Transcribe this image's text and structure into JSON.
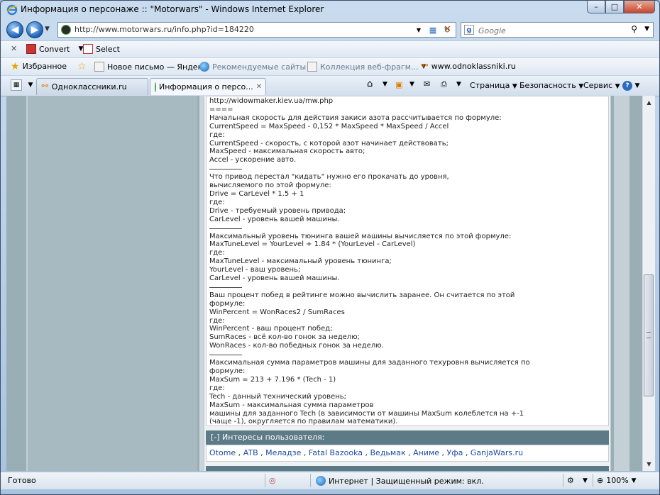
{
  "window": {
    "title": "Информация о персонаже :: \"Motorwars\" - Windows Internet Explorer",
    "minimize": "–",
    "maximize": "□",
    "close": "✕"
  },
  "nav": {
    "back": "◀",
    "forward": "▶",
    "url": "http://www.motorwars.ru/info.php?id=184220",
    "search_placeholder": "Google"
  },
  "command_bar": {
    "close": "✕",
    "convert_label": "Convert",
    "select_label": "Select"
  },
  "favorites_bar": {
    "favorites_label": "Избранное",
    "items": [
      {
        "label": "Новое письмо — Яндекс"
      },
      {
        "label": "Рекомендуемые сайты"
      },
      {
        "label": "Коллекция веб-фрагм..."
      },
      {
        "label": "www.odnoklassniki.ru"
      }
    ]
  },
  "tabs": {
    "items": [
      {
        "label": "Одноклассники.ru"
      },
      {
        "label": "Информация о персо..."
      }
    ],
    "tab_close": "✕",
    "toolbar": {
      "page": "Страница",
      "security": "Безопасность",
      "tools": "Сервис",
      "help": "?"
    }
  },
  "post": {
    "lines": [
      "http://widowmaker.kiev.ua/mw.php",
      "====",
      "Начальная скорость для действия закиси азота рассчитывается по формуле:",
      "CurrentSpeed = MaxSpeed - 0,152 * MaxSpeed * MaxSpeed / Accel",
      "где:",
      "CurrentSpeed - скорость, с которой азот начинает действовать;",
      "MaxSpeed - максимальная скорость авто;",
      "Accel - ускорение авто.",
      "",
      "Что привод перестал \"кидать\" нужно его прокачать до уровня,",
      "вычисляемого по этой формуле:",
      "Drive = CarLevel * 1.5 + 1",
      "где:",
      "Drive - требуемый уровень привода;",
      "CarLevel - уровень вашей машины.",
      "",
      "Максимальный уровень тюнинга вашей машины вычисляется по этой формуле:",
      "MaxTuneLevel = YourLevel + 1.84 * (YourLevel - CarLevel)",
      "где:",
      "MaxTuneLevel - максимальный уровень тюнинга;",
      "YourLevel - ваш уровень;",
      "CarLevel - уровень вашей машины.",
      "",
      "Ваш процент побед в рейтинге можно вычислить заранее. Он считается по этой",
      "формуле:",
      "WinPercent = WonRaces2 / SumRaces",
      "где:",
      "WinPercent - ваш процент побед;",
      "SumRaces - всё кол-во гонок за неделю;",
      "WonRaces - кол-во победных гонок за неделю.",
      "",
      "Максимальная сумма параметров машины для заданного техуровня вычисляется по",
      "формуле:",
      "MaxSum = 213 + 7.196 * (Tech - 1)",
      "где:",
      "Tech - данный технический уровень;",
      "MaxSum - максимальная сумма параметров",
      "машины для заданного Tech (в зависимости от машины MaxSum колеблется на +-1",
      "(чаще -1), округляется по правилам математики)."
    ]
  },
  "interests": {
    "header": "[-]  Интересы пользователя:",
    "items": [
      "Otome",
      "ATB",
      "Меладзе",
      "Fatal Bazooka",
      "Ведьмак",
      "Аниме",
      "Уфа",
      "GanjaWars.ru"
    ],
    "separator": " , "
  },
  "status_bar": {
    "status": "Готово",
    "zone": "Интернет | Защищенный режим: вкл.",
    "zoom": "100%"
  },
  "colors": {
    "section_header": "#5d7b86",
    "side_column": "#9aaeb6",
    "link": "#1c4da0"
  }
}
